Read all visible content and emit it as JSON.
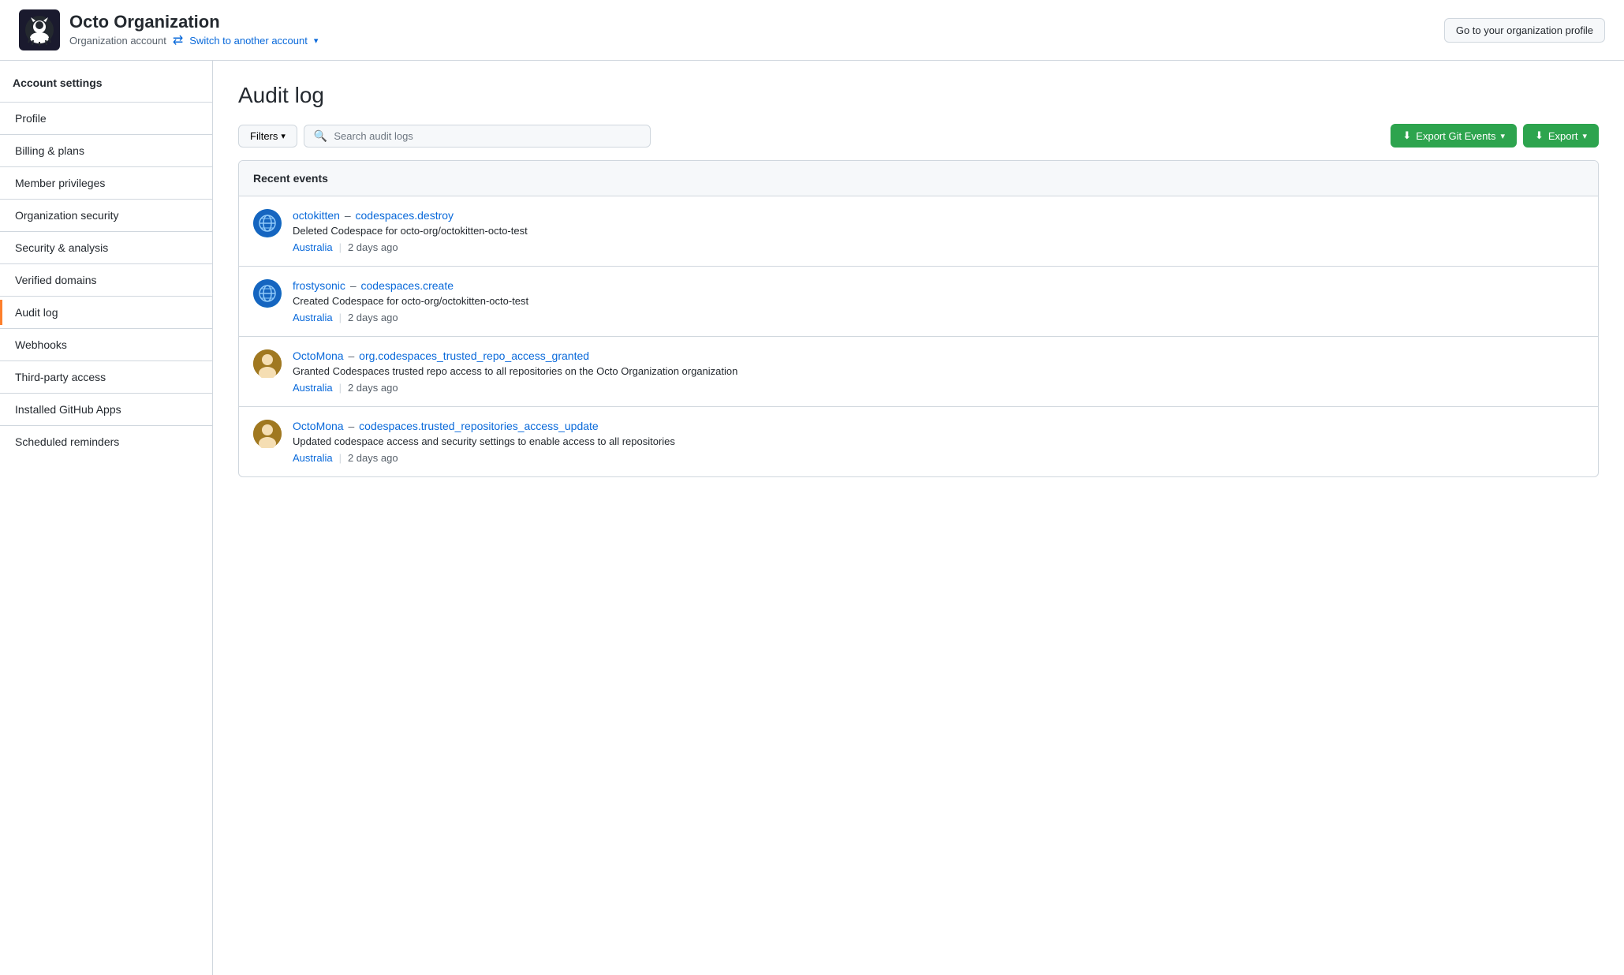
{
  "header": {
    "org_name": "Octo Organization",
    "org_sub": "Organization account",
    "switch_label": "Switch to another account",
    "org_profile_btn": "Go to your organization profile"
  },
  "sidebar": {
    "heading": "Account settings",
    "items": [
      {
        "label": "Profile",
        "id": "profile",
        "active": false
      },
      {
        "label": "Billing & plans",
        "id": "billing",
        "active": false
      },
      {
        "label": "Member privileges",
        "id": "member-privileges",
        "active": false
      },
      {
        "label": "Organization security",
        "id": "org-security",
        "active": false
      },
      {
        "label": "Security & analysis",
        "id": "security-analysis",
        "active": false
      },
      {
        "label": "Verified domains",
        "id": "verified-domains",
        "active": false
      },
      {
        "label": "Audit log",
        "id": "audit-log",
        "active": true
      },
      {
        "label": "Webhooks",
        "id": "webhooks",
        "active": false
      },
      {
        "label": "Third-party access",
        "id": "third-party",
        "active": false
      },
      {
        "label": "Installed GitHub Apps",
        "id": "github-apps",
        "active": false
      },
      {
        "label": "Scheduled reminders",
        "id": "scheduled-reminders",
        "active": false
      }
    ]
  },
  "main": {
    "title": "Audit log",
    "toolbar": {
      "filters_label": "Filters",
      "search_placeholder": "Search audit logs",
      "export_git_events_label": "Export Git Events",
      "export_label": "Export"
    },
    "events_section": {
      "heading": "Recent events",
      "events": [
        {
          "id": 1,
          "actor": "octokitten",
          "action": "codespaces.destroy",
          "description": "Deleted Codespace for octo-org/octokitten-octo-test",
          "location": "Australia",
          "time": "2 days ago",
          "avatar_type": "globe"
        },
        {
          "id": 2,
          "actor": "frostysonic",
          "action": "codespaces.create",
          "description": "Created Codespace for octo-org/octokitten-octo-test",
          "location": "Australia",
          "time": "2 days ago",
          "avatar_type": "globe"
        },
        {
          "id": 3,
          "actor": "OctoMona",
          "action": "org.codespaces_trusted_repo_access_granted",
          "description": "Granted Codespaces trusted repo access to all repositories on the Octo Organization organization",
          "location": "Australia",
          "time": "2 days ago",
          "avatar_type": "person"
        },
        {
          "id": 4,
          "actor": "OctoMona",
          "action": "codespaces.trusted_repositories_access_update",
          "description": "Updated codespace access and security settings to enable access to all repositories",
          "location": "Australia",
          "time": "2 days ago",
          "avatar_type": "person"
        }
      ]
    }
  }
}
